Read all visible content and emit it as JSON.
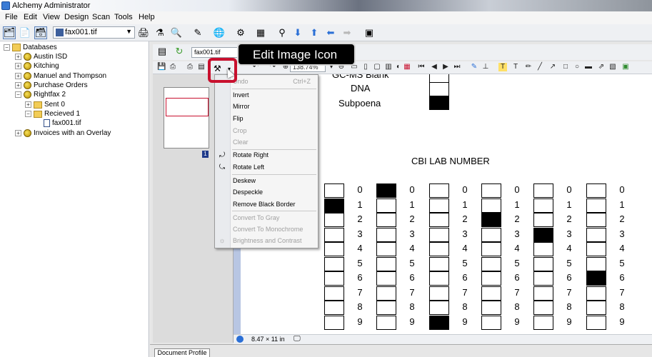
{
  "window": {
    "title": "Alchemy Administrator"
  },
  "menubar": {
    "items": [
      "File",
      "Edit",
      "View",
      "Design",
      "Scan",
      "Tools",
      "Help"
    ]
  },
  "toolbar": {
    "file_selector_value": "fax001.tif"
  },
  "tree": {
    "root": "Databases",
    "items": [
      {
        "label": "Austin ISD",
        "level": 1,
        "icon": "database-icon"
      },
      {
        "label": "Kitching",
        "level": 1,
        "icon": "database-icon"
      },
      {
        "label": "Manuel and Thompson",
        "level": 1,
        "icon": "database-icon"
      },
      {
        "label": "Purchase Orders",
        "level": 1,
        "icon": "database-icon"
      },
      {
        "label": "Rightfax 2",
        "level": 1,
        "icon": "database-icon"
      },
      {
        "label": "Sent 0",
        "level": 2,
        "icon": "folder-icon"
      },
      {
        "label": "Recieved 1",
        "level": 2,
        "icon": "folder-icon"
      },
      {
        "label": "fax001.tif",
        "level": 3,
        "icon": "document-icon"
      },
      {
        "label": "Invoices with an Overlay",
        "level": 1,
        "icon": "database-icon"
      }
    ]
  },
  "doc_tab": {
    "label": "fax001.tif"
  },
  "viewer": {
    "zoom": "138.74%"
  },
  "thumbnail": {
    "page_number": "1"
  },
  "tooltip": {
    "text": "Edit Image Icon"
  },
  "context_menu": {
    "items": [
      {
        "label": "Undo",
        "shortcut": "Ctrl+Z",
        "disabled": true
      },
      {
        "label": "Invert",
        "disabled": false
      },
      {
        "label": "Mirror",
        "disabled": false
      },
      {
        "label": "Flip",
        "disabled": false
      },
      {
        "label": "Crop",
        "disabled": true
      },
      {
        "label": "Clear",
        "disabled": true
      },
      {
        "label": "Rotate Right",
        "disabled": false
      },
      {
        "label": "Rotate Left",
        "disabled": false
      },
      {
        "label": "Deskew",
        "disabled": false
      },
      {
        "label": "Despeckle",
        "disabled": false
      },
      {
        "label": "Remove Black Border",
        "disabled": false
      },
      {
        "label": "Convert To Gray",
        "disabled": true
      },
      {
        "label": "Convert To Monochrome",
        "disabled": true
      },
      {
        "label": "Brightness and Contrast",
        "disabled": true
      }
    ]
  },
  "document": {
    "top_labels": [
      "GC-MS Blank",
      "DNA",
      "Subpoena"
    ],
    "heading": "CBI LAB NUMBER",
    "digits": [
      "0",
      "1",
      "2",
      "3",
      "4",
      "5",
      "6",
      "7",
      "8",
      "9"
    ]
  },
  "status": {
    "page_size": "8.47 × 11 in"
  },
  "bottom_tab": {
    "label": "Document Profile"
  }
}
